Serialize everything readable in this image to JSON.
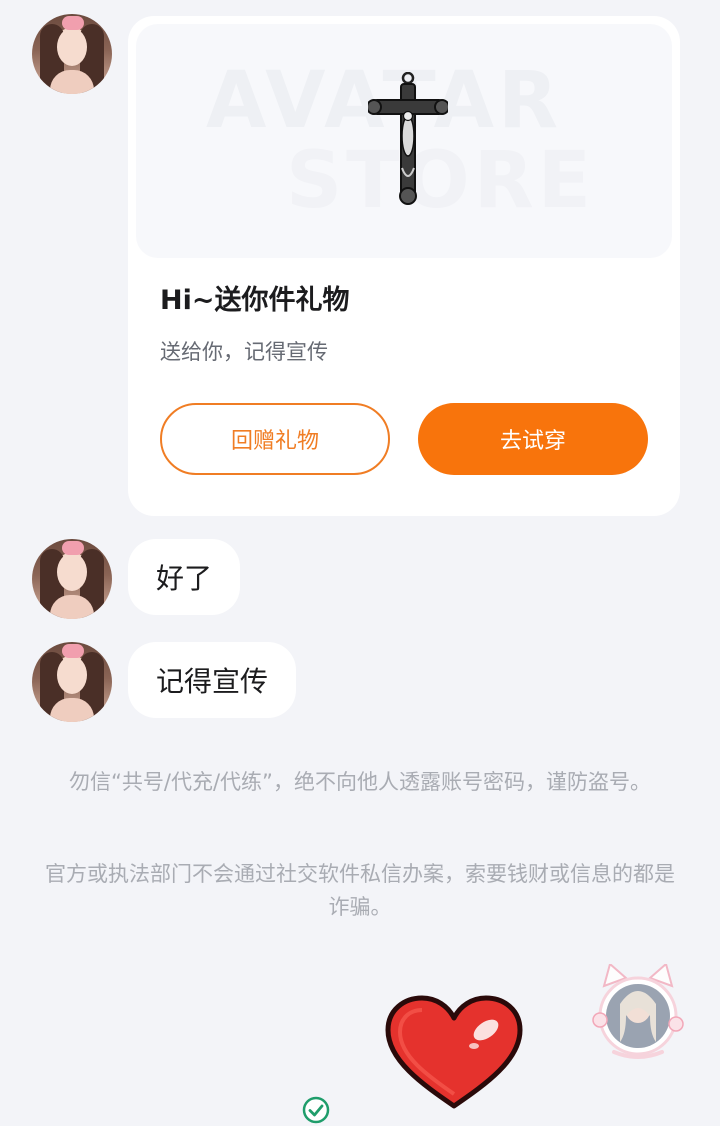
{
  "gift_card": {
    "watermark_line1": "AVATAR",
    "watermark_line2": "STORE",
    "title": "Hi~送你件礼物",
    "subtitle": "送给你，记得宣传",
    "return_gift_label": "回赠礼物",
    "try_on_label": "去试穿"
  },
  "messages": [
    {
      "text": "好了"
    },
    {
      "text": "记得宣传"
    }
  ],
  "notices": [
    "勿信“共号/代充/代练”，绝不向他人透露账号密码，谨防盗号。",
    "官方或执法部门不会通过社交软件私信办案，索要钱财或信息的都是诈骗。"
  ],
  "colors": {
    "accent": "#f8740c",
    "background": "#f3f4f8",
    "bubble": "#ffffff",
    "notice_text": "#a9acb3",
    "sent_check": "#1f9d6b"
  },
  "icons": {
    "sticker": "red-heart-sticker",
    "status": "check-circle-icon",
    "floating": "cat-ear-avatar-frame"
  }
}
